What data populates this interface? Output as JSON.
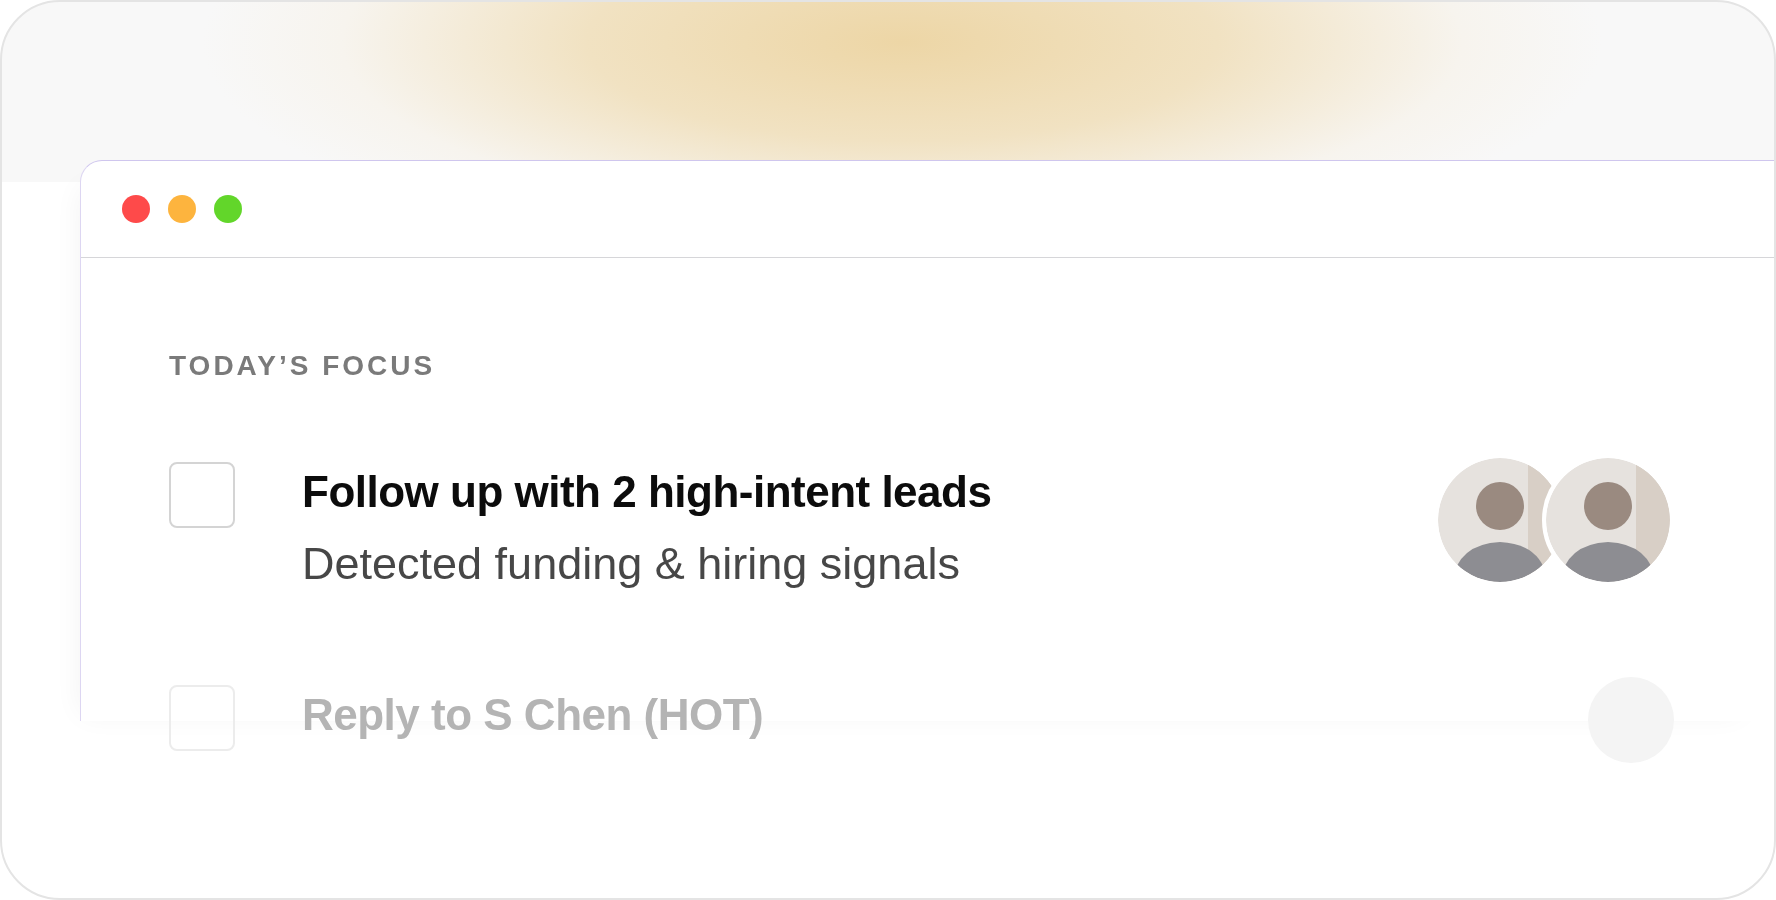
{
  "window": {
    "controls": [
      {
        "color": "#fe4a4a"
      },
      {
        "color": "#fdb43e"
      },
      {
        "color": "#62d62a"
      }
    ]
  },
  "section_title": "TODAY’S FOCUS",
  "tasks": [
    {
      "title": "Follow up with 2 high-intent leads",
      "subtitle": "Detected funding & hiring signals",
      "checked": false,
      "faded": false,
      "avatars": [
        {
          "kind": "photo"
        },
        {
          "kind": "photo"
        }
      ]
    },
    {
      "title": "Reply to S Chen (HOT)",
      "checked": false,
      "faded": true,
      "avatars": [
        {
          "kind": "photo"
        }
      ]
    }
  ]
}
